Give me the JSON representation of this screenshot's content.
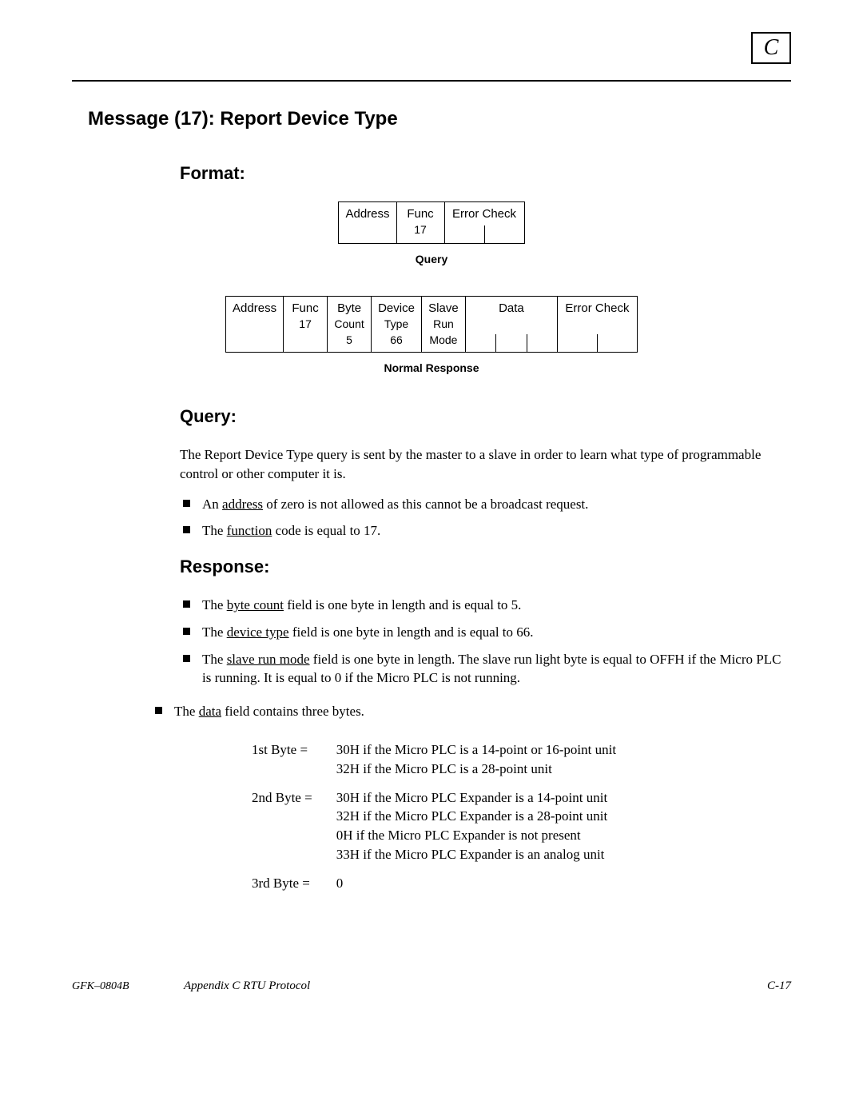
{
  "corner_label": "C",
  "title": "Message  (17): Report Device Type",
  "format_heading": "Format:",
  "query_packet": {
    "address": "Address",
    "func_line1": "Func",
    "func_line2": "17",
    "errchk": "Error Check"
  },
  "query_caption": "Query",
  "response_packet": {
    "address": "Address",
    "func_line1": "Func",
    "func_line2": "17",
    "bytecount_line1": "Byte",
    "bytecount_line2": "Count",
    "bytecount_line3": "5",
    "devtype_line1": "Device",
    "devtype_line2": "Type",
    "devtype_line3": "66",
    "slave_line1": "Slave",
    "slave_line2": "Run",
    "slave_line3": "Mode",
    "data": "Data",
    "errchk": "Error Check"
  },
  "response_caption": "Normal Response",
  "query_heading": "Query:",
  "query_para": "The Report Device Type query is sent by the master to a slave in order to learn what type of programmable control or other computer it is.",
  "query_bullets": {
    "b1_pre": "An ",
    "b1_u": "address",
    "b1_post": " of zero is not allowed as this cannot be  a broadcast request.",
    "b2_pre": "The ",
    "b2_u": "function",
    "b2_post": " code is equal to 17."
  },
  "response_heading": "Response:",
  "response_bullets": {
    "b1_pre": "The ",
    "b1_u": "byte count",
    "b1_post": " field is one byte in length and is equal to 5.",
    "b2_pre": "The ",
    "b2_u": "device type",
    "b2_post": " field is one byte in length and is equal to 66.",
    "b3_pre": "The ",
    "b3_u": "slave run mode",
    "b3_post": " field is one byte in length.  The slave run light byte is equal to OFFH if the Micro PLC is running.  It is equal to 0 if the Micro PLC is not running.",
    "b4_pre": "The ",
    "b4_u": "data",
    "b4_post": " field contains three bytes."
  },
  "bytes": {
    "row1_label": "1st Byte  =",
    "row1_text_l1": "30H if the Micro PLC is a 14-point or 16-point unit",
    "row1_text_l2": "32H if the Micro PLC is a 28-point unit",
    "row2_label": "2nd Byte  =",
    "row2_text_l1": "30H if the Micro PLC Expander is a 14-point unit",
    "row2_text_l2": "32H if the Micro PLC Expander is a 28-point unit",
    "row2_text_l3": "0H if the Micro PLC Expander is not present",
    "row2_text_l4": "33H if the Micro PLC Expander is an analog unit",
    "row3_label": "3rd Byte  =",
    "row3_text": "0"
  },
  "footer": {
    "left": "GFK–0804B",
    "center": "Appendix C  RTU Protocol",
    "right": "C-17"
  }
}
